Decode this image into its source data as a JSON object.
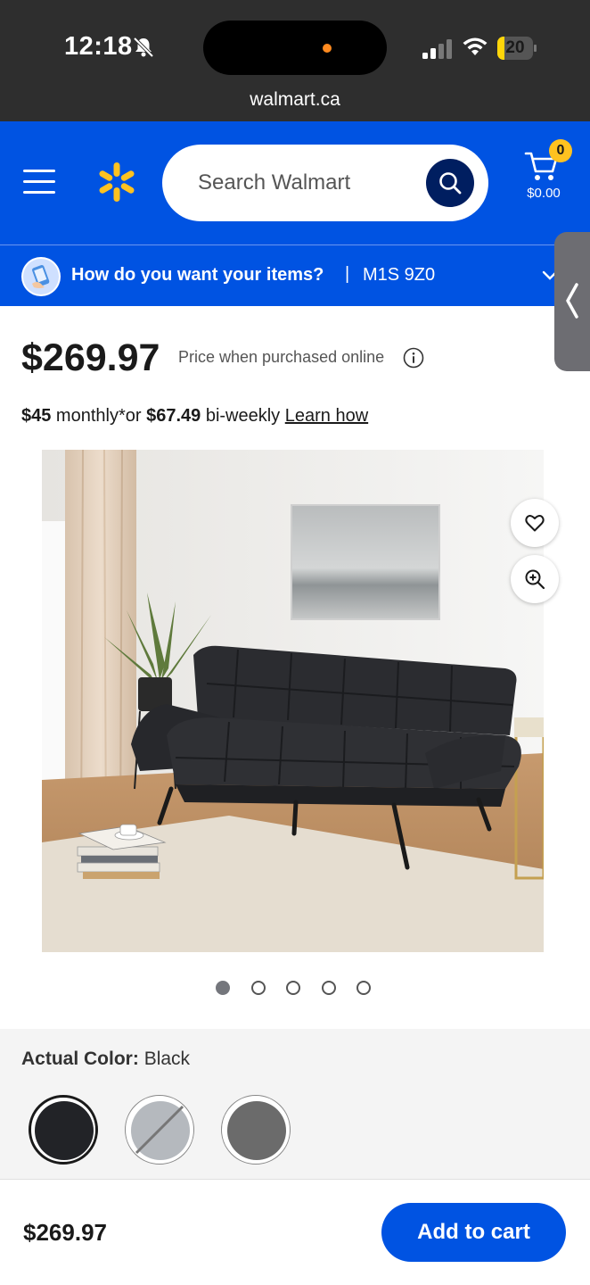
{
  "status_bar": {
    "time": "12:18",
    "battery_level": "20",
    "url": "walmart.ca",
    "icons": [
      "bell-slash-icon",
      "signal-icon",
      "wifi-icon",
      "battery-icon"
    ]
  },
  "header": {
    "search_placeholder": "Search Walmart",
    "cart_count": "0",
    "cart_total": "$0.00",
    "brand_color": "#0053e2",
    "accent_color": "#ffc220"
  },
  "delivery": {
    "question": "How do you want your items?",
    "separator": "|",
    "postal_code": "M1S 9Z0"
  },
  "product": {
    "price": "$269.97",
    "price_note": "Price when purchased online",
    "finance": {
      "monthly_amount": "$45",
      "monthly_text": " monthly*or ",
      "biweekly_amount": "$67.49",
      "biweekly_text": " bi-weekly ",
      "learn_link": "Learn how"
    },
    "image_alt": "Black futon sofa in living room",
    "carousel": {
      "count": 5,
      "active_index": 0
    },
    "color_label": "Actual Color:",
    "color_value": "Black",
    "swatches": [
      {
        "color": "#222327",
        "selected": true
      },
      {
        "color": "#b5b9be",
        "selected": false,
        "unavailable": true
      },
      {
        "color": "#6b6b6b",
        "selected": false
      }
    ]
  },
  "bottom_bar": {
    "price": "$269.97",
    "add_to_cart_label": "Add to cart"
  }
}
